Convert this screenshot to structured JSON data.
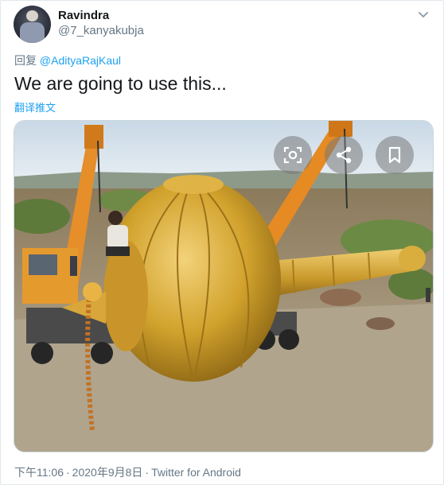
{
  "author": {
    "name": "Ravindra",
    "handle": "@7_kanyakubja"
  },
  "reply": {
    "prefix": "回复",
    "mention": "@AdityaRajKaul"
  },
  "tweet": {
    "text": "We are going to use this...",
    "translate_label": "翻译推文"
  },
  "media": {
    "overlay_icons": [
      "lens-search-icon",
      "share-icon",
      "bookmark-icon"
    ]
  },
  "meta": {
    "time": "下午11:06",
    "date": "2020年9月8日",
    "source": "Twitter for Android",
    "separator": "·"
  },
  "colors": {
    "link": "#1da1f2",
    "secondary": "#657786",
    "text": "#14171a",
    "gold": "#d1a22c"
  }
}
